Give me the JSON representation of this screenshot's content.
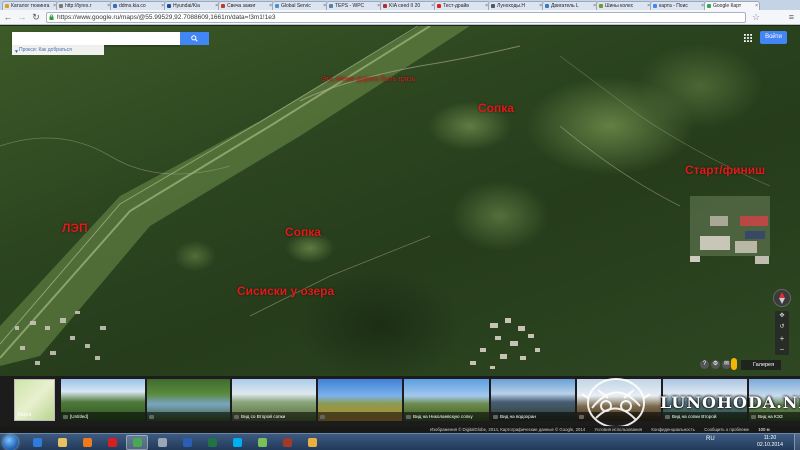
{
  "browser": {
    "tabs": [
      {
        "label": "Каталог тюнинга",
        "favicon_color": "#d8a020"
      },
      {
        "label": "http://tyres.r",
        "favicon_color": "#7a7a7a"
      },
      {
        "label": "ddms.kia.co",
        "favicon_color": "#3a6db3"
      },
      {
        "label": "Hyundai/Kia",
        "favicon_color": "#1a4f9c"
      },
      {
        "label": "Свеча зажиг",
        "favicon_color": "#c0392b"
      },
      {
        "label": "Global Servic",
        "favicon_color": "#4a8fd4"
      },
      {
        "label": "TEPS - WPC",
        "favicon_color": "#5b7fa5"
      },
      {
        "label": "KIA ceed II 20",
        "favicon_color": "#b03030"
      },
      {
        "label": "Тест-драйв",
        "favicon_color": "#e02020"
      },
      {
        "label": "Луноходы.Н",
        "favicon_color": "#555555"
      },
      {
        "label": "Двигатель L",
        "favicon_color": "#3a7ac0"
      },
      {
        "label": "Шины колес",
        "favicon_color": "#6a9a30"
      },
      {
        "label": "карта - Поис",
        "favicon_color": "#4285f4"
      },
      {
        "label": "Google Карт",
        "favicon_color": "#34a853",
        "active": true
      }
    ],
    "url": "https://www.google.ru/maps/@55.99529,92.7088609,1661m/data=!3m1!1e3",
    "back_icon": "back-arrow-icon",
    "forward_icon": "forward-arrow-icon",
    "reload_icon": "reload-icon"
  },
  "map": {
    "search": {
      "placeholder": "",
      "hint": "Прокси: Как добраться"
    },
    "signin_label": "Войти",
    "labels": {
      "dirt_road": "Эта линия дорога быть грязь",
      "field_top": "Сопка",
      "start_finish": "Старт/финиш",
      "lep": "ЛЭП",
      "field_mid": "Сопка",
      "lake": "Сисиски у озера"
    },
    "gallery_label": "Галерея",
    "controls": {
      "zoom_in": "+",
      "zoom_out": "−"
    }
  },
  "photos": [
    {
      "caption": "Карта",
      "kind": "mini"
    },
    {
      "caption": "[Untitled]",
      "kind": "photo"
    },
    {
      "caption": "",
      "kind": "photo"
    },
    {
      "caption": "Вид со Второй сопки",
      "kind": "photo"
    },
    {
      "caption": "",
      "kind": "photo"
    },
    {
      "caption": "Вид на Николаевскую сопку",
      "kind": "photo"
    },
    {
      "caption": "Вид на водохран",
      "kind": "photo"
    },
    {
      "caption": "",
      "kind": "photo"
    },
    {
      "caption": "Вид на сопки Второй",
      "kind": "photo"
    },
    {
      "caption": "Вид на КЭЗ",
      "kind": "photo"
    }
  ],
  "watermark": "LUNOHODA.NET",
  "attribution": {
    "imagery": "Изображения © DigitalGlobe, 2014, Картографические данные © Google, 2014",
    "terms": "Условия использования",
    "privacy": "Конфиденциальность",
    "report": "Сообщить о проблеме",
    "scale": "100 м"
  },
  "taskbar": {
    "lang": "RU",
    "time": "11:20",
    "date": "02.10.2014",
    "apps": [
      {
        "name": "ie-icon",
        "color": "#2f7bd8"
      },
      {
        "name": "explorer-icon",
        "color": "#e8c060"
      },
      {
        "name": "media-player-icon",
        "color": "#f07a1a"
      },
      {
        "name": "opera-icon",
        "color": "#d42020"
      },
      {
        "name": "chrome-icon",
        "color": "#4aa853",
        "active": true
      },
      {
        "name": "settings-icon",
        "color": "#9aa5b5"
      },
      {
        "name": "word-icon",
        "color": "#2b5db5"
      },
      {
        "name": "excel-icon",
        "color": "#217346"
      },
      {
        "name": "skype-icon",
        "color": "#00aff0"
      },
      {
        "name": "tool-icon",
        "color": "#7ac05a"
      },
      {
        "name": "paint-icon",
        "color": "#a03a2a"
      },
      {
        "name": "folder-icon",
        "color": "#e8b040"
      }
    ]
  },
  "colors": {
    "label_red": "#e21a1a",
    "google_blue": "#4285f4"
  }
}
